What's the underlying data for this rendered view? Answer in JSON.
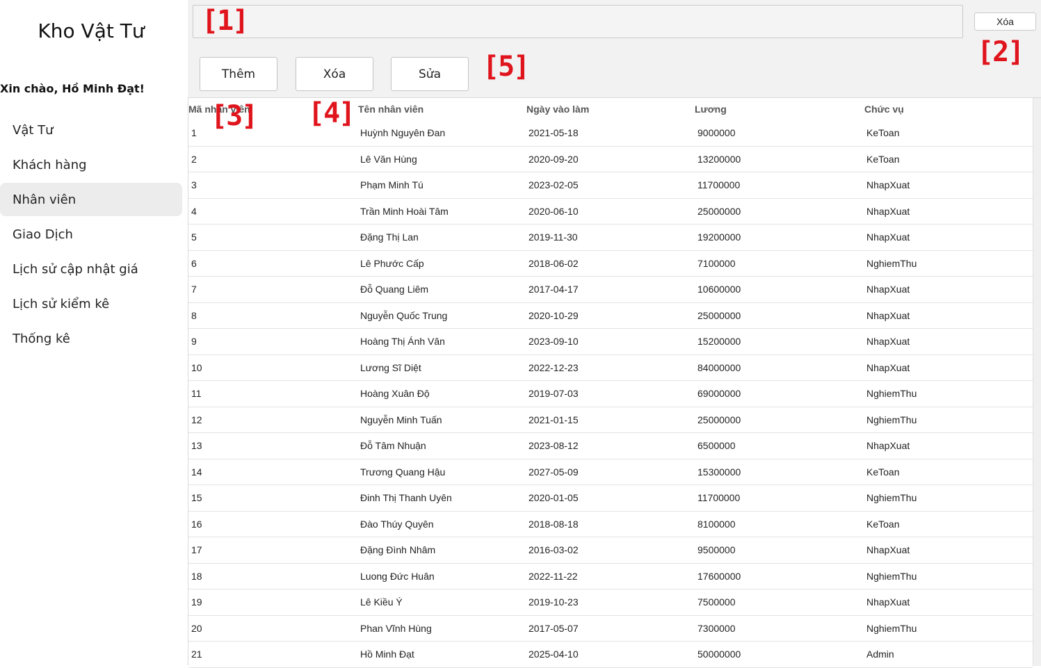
{
  "app": {
    "title": "Kho Vật Tư",
    "greeting": "Xin chào, Hồ Minh Đạt!"
  },
  "sidebar": {
    "items": [
      {
        "label": "Vật Tư",
        "active": false
      },
      {
        "label": "Khách hàng",
        "active": false
      },
      {
        "label": "Nhân viên",
        "active": true
      },
      {
        "label": "Giao Dịch",
        "active": false
      },
      {
        "label": "Lịch sử cập nhật giá",
        "active": false
      },
      {
        "label": "Lịch sử kiểm kê",
        "active": false
      },
      {
        "label": "Thống kê",
        "active": false
      }
    ]
  },
  "search": {
    "value": "",
    "placeholder": ""
  },
  "toolbar": {
    "clear_label": "Xóa",
    "add_label": "Thêm",
    "delete_label": "Xóa",
    "edit_label": "Sửa"
  },
  "annotations": [
    "[1]",
    "[2]",
    "[3]",
    "[4]",
    "[5]"
  ],
  "table": {
    "columns": [
      "Mã nhân viên",
      "Tên nhân viên",
      "Ngày vào làm",
      "Lương",
      "Chức vụ"
    ],
    "rows": [
      [
        "1",
        "Huỳnh Nguyên Đan",
        "2021-05-18",
        "9000000",
        "KeToan"
      ],
      [
        "2",
        "Lê Văn Hùng",
        "2020-09-20",
        "13200000",
        "KeToan"
      ],
      [
        "3",
        "Phạm Minh Tú",
        "2023-02-05",
        "11700000",
        "NhapXuat"
      ],
      [
        "4",
        "Trần Minh Hoài Tâm",
        "2020-06-10",
        "25000000",
        "NhapXuat"
      ],
      [
        "5",
        "Đặng Thị Lan",
        "2019-11-30",
        "19200000",
        "NhapXuat"
      ],
      [
        "6",
        "Lê Phước Cấp",
        "2018-06-02",
        "7100000",
        "NghiemThu"
      ],
      [
        "7",
        "Đỗ Quang Liêm",
        "2017-04-17",
        "10600000",
        "NhapXuat"
      ],
      [
        "8",
        "Nguyễn Quốc Trung",
        "2020-10-29",
        "25000000",
        "NhapXuat"
      ],
      [
        "9",
        "Hoàng Thị Ánh Vân",
        "2023-09-10",
        "15200000",
        "NhapXuat"
      ],
      [
        "10",
        "Lương Sĩ Diệt",
        "2022-12-23",
        "84000000",
        "NhapXuat"
      ],
      [
        "11",
        "Hoàng Xuân Độ",
        "2019-07-03",
        "69000000",
        "NghiemThu"
      ],
      [
        "12",
        "Nguyễn Minh Tuấn",
        "2021-01-15",
        "25000000",
        "NghiemThu"
      ],
      [
        "13",
        "Đỗ Tâm Nhuận",
        "2023-08-12",
        "6500000",
        "NhapXuat"
      ],
      [
        "14",
        "Trương Quang Hậu",
        "2027-05-09",
        "15300000",
        "KeToan"
      ],
      [
        "15",
        "Đinh Thị Thanh Uyên",
        "2020-01-05",
        "11700000",
        "NghiemThu"
      ],
      [
        "16",
        "Đào Thúy Quyên",
        "2018-08-18",
        "8100000",
        "KeToan"
      ],
      [
        "17",
        "Đặng Đình Nhâm",
        "2016-03-02",
        "9500000",
        "NhapXuat"
      ],
      [
        "18",
        "Luong Đức Huân",
        "2022-11-22",
        "17600000",
        "NghiemThu"
      ],
      [
        "19",
        "Lê Kiều Ý",
        "2019-10-23",
        "7500000",
        "NhapXuat"
      ],
      [
        "20",
        "Phan Vĩnh Hùng",
        "2017-05-07",
        "7300000",
        "NghiemThu"
      ],
      [
        "21",
        "Hồ Minh Đạt",
        "2025-04-10",
        "50000000",
        "Admin"
      ]
    ]
  }
}
